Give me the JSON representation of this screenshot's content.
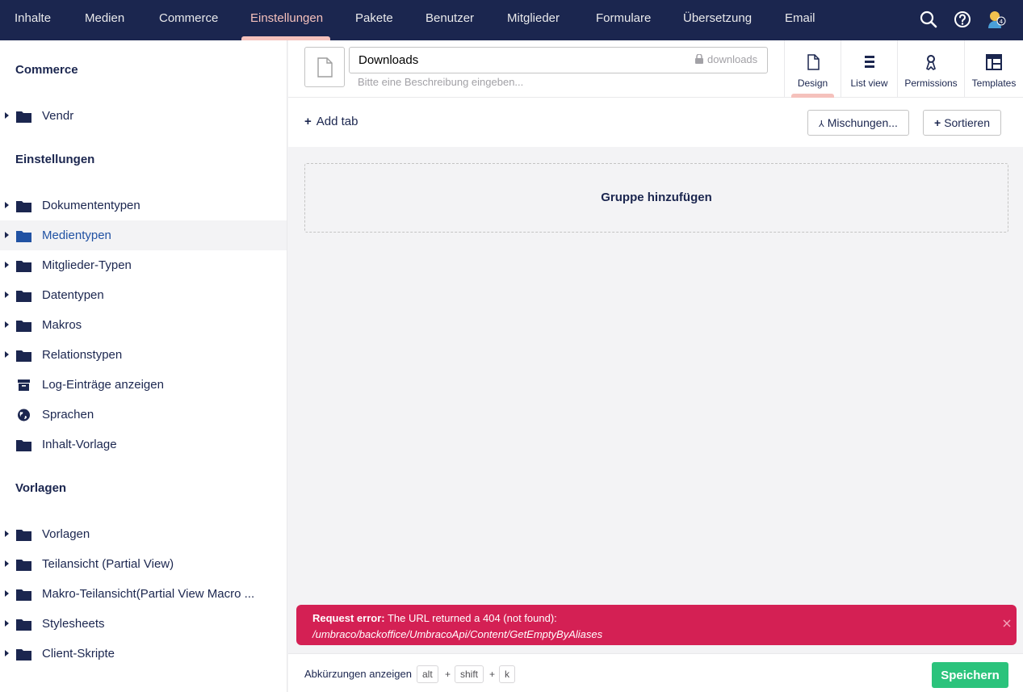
{
  "topnav": {
    "items": [
      {
        "label": "Inhalte"
      },
      {
        "label": "Medien"
      },
      {
        "label": "Commerce"
      },
      {
        "label": "Einstellungen"
      },
      {
        "label": "Pakete"
      },
      {
        "label": "Benutzer"
      },
      {
        "label": "Mitglieder"
      },
      {
        "label": "Formulare"
      },
      {
        "label": "Übersetzung"
      },
      {
        "label": "Email"
      }
    ],
    "active": "Einstellungen",
    "icons": [
      "search-icon",
      "help-icon",
      "user-avatar-icon"
    ],
    "colors": {
      "background": "#1b264f",
      "active": "#f5c1bc"
    }
  },
  "sidebar": {
    "sections": [
      {
        "title": "Commerce",
        "items": [
          {
            "label": "Vendr",
            "icon": "folder-icon",
            "expandable": true
          }
        ]
      },
      {
        "title": "Einstellungen",
        "items": [
          {
            "label": "Dokumententypen",
            "icon": "folder-icon",
            "expandable": true
          },
          {
            "label": "Medientypen",
            "icon": "folder-icon",
            "expandable": true,
            "active": true
          },
          {
            "label": "Mitglieder-Typen",
            "icon": "folder-icon",
            "expandable": true
          },
          {
            "label": "Datentypen",
            "icon": "folder-icon",
            "expandable": true
          },
          {
            "label": "Makros",
            "icon": "folder-icon",
            "expandable": true
          },
          {
            "label": "Relationstypen",
            "icon": "folder-icon",
            "expandable": true
          },
          {
            "label": "Log-Einträge anzeigen",
            "icon": "box-icon",
            "expandable": false
          },
          {
            "label": "Sprachen",
            "icon": "globe-icon",
            "expandable": false
          },
          {
            "label": "Inhalt-Vorlage",
            "icon": "folder-icon",
            "expandable": false
          }
        ]
      },
      {
        "title": "Vorlagen",
        "items": [
          {
            "label": "Vorlagen",
            "icon": "folder-icon",
            "expandable": true
          },
          {
            "label": "Teilansicht (Partial View)",
            "icon": "folder-icon",
            "expandable": true
          },
          {
            "label": "Makro-Teilansicht(Partial View Macro ...",
            "icon": "folder-icon",
            "expandable": true
          },
          {
            "label": "Stylesheets",
            "icon": "folder-icon",
            "expandable": true
          },
          {
            "label": "Client-Skripte",
            "icon": "folder-icon",
            "expandable": true
          }
        ]
      }
    ]
  },
  "editor": {
    "name_value": "Downloads",
    "alias": "downloads",
    "description_placeholder": "Bitte eine Beschreibung eingeben...",
    "tabs": [
      {
        "label": "Design",
        "icon": "document-icon",
        "active": true
      },
      {
        "label": "List view",
        "icon": "list-icon"
      },
      {
        "label": "Permissions",
        "icon": "key-icon"
      },
      {
        "label": "Templates",
        "icon": "layout-icon"
      }
    ],
    "add_tab_label": "Add tab",
    "compositions_label": "Mischungen...",
    "sort_label": "Sortieren",
    "add_group_label": "Gruppe hinzufügen"
  },
  "error": {
    "title": "Request error:",
    "message": "The URL returned a 404 (not found):",
    "url": "/umbraco/backoffice/UmbracoApi/Content/GetEmptyByAliases",
    "color": "#d42054"
  },
  "footer": {
    "shortcuts_label": "Abkürzungen anzeigen",
    "keys": [
      "alt",
      "shift",
      "k"
    ],
    "plus": "+",
    "save_label": "Speichern",
    "save_color": "#2bc37c"
  }
}
